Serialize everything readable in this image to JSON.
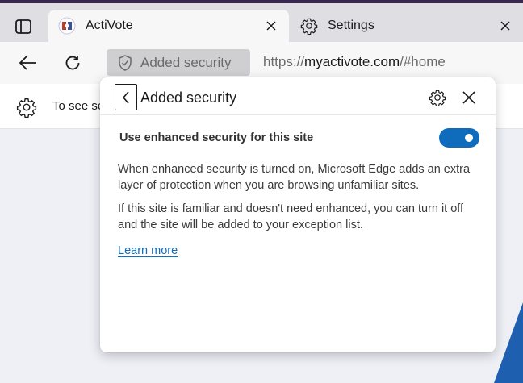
{
  "tabs": {
    "active": {
      "title": "ActiVote"
    },
    "inactive": {
      "title": "Settings"
    }
  },
  "addressbar": {
    "site_badge": "Added security",
    "url_prefix": "https://",
    "url_host": "myactivote.com",
    "url_path": "/#home"
  },
  "infobar": {
    "text": "To see se"
  },
  "popup": {
    "title": "Added security",
    "toggle_label": "Use enhanced security for this site",
    "toggle_on": true,
    "paragraph1": "When enhanced security is turned on, Microsoft Edge adds an extra layer of protection when you are browsing unfamiliar sites.",
    "paragraph2": "If this site is familiar and doesn't need enhanced, you can turn it off and the site will be added to your exception list.",
    "learn_more": "Learn more"
  },
  "colors": {
    "accent": "#0f6cbd",
    "link": "#106ebe",
    "tabstrip_top": "#36284f"
  }
}
